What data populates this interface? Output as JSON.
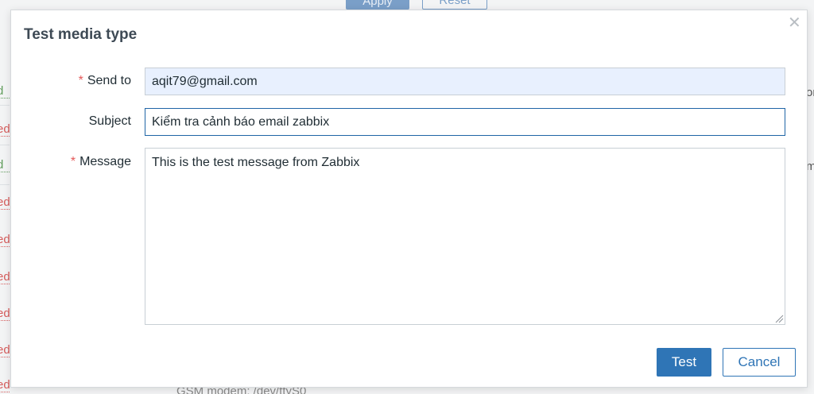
{
  "background": {
    "apply_label": "Apply",
    "reset_label": "Reset",
    "status_fragments": [
      "d",
      "ed",
      "d",
      "ed",
      "ed",
      "ed",
      "ed",
      "ed",
      "ed"
    ],
    "right_fragments": [
      "or",
      "m"
    ],
    "bottom_text": "GSM modem: /dev/ttyS0"
  },
  "dialog": {
    "title": "Test media type",
    "close_icon": "close-icon",
    "fields": {
      "send_to": {
        "label": "Send to",
        "required": true,
        "value": "aqit79@gmail.com"
      },
      "subject": {
        "label": "Subject",
        "required": false,
        "value": "Kiểm tra cảnh báo email zabbix"
      },
      "message": {
        "label": "Message",
        "required": true,
        "value": "This is the test message from Zabbix"
      }
    },
    "buttons": {
      "test_label": "Test",
      "cancel_label": "Cancel"
    },
    "required_marker": "*"
  },
  "colors": {
    "accent": "#2f75b6",
    "required": "#e45959",
    "autofill_bg": "#e8f0fe",
    "enabled_status": "#5f9b5a",
    "disabled_status": "#d65c5c"
  }
}
